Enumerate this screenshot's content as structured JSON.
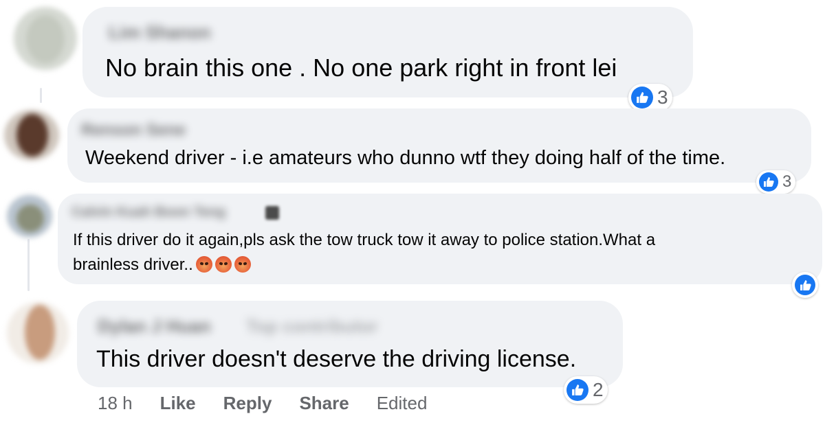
{
  "comments": [
    {
      "author": "Lim Shanon",
      "text": "No brain this one . No one park right in front lei",
      "reaction_count": "3"
    },
    {
      "author": "Renson Sene",
      "text": "Weekend driver - i.e amateurs who dunno wtf they doing half of the time.",
      "reaction_count": "3"
    },
    {
      "author": "Calvin Kuah Boon Teng",
      "text_line1": "If this driver do it again,pls ask the tow truck tow it away to police station.What a",
      "text_line2": "brainless driver..",
      "reaction_count": ""
    },
    {
      "author": "Dylan J Huan",
      "author_badge": "Top contributor",
      "text": "This driver doesn't deserve the driving license.",
      "reaction_count": "2"
    }
  ],
  "actions": {
    "time": "18 h",
    "like": "Like",
    "reply": "Reply",
    "share": "Share",
    "edited": "Edited"
  },
  "colors": {
    "bubble": "#f0f2f5",
    "like_blue": "#1877f2",
    "meta_gray": "#65676b"
  }
}
